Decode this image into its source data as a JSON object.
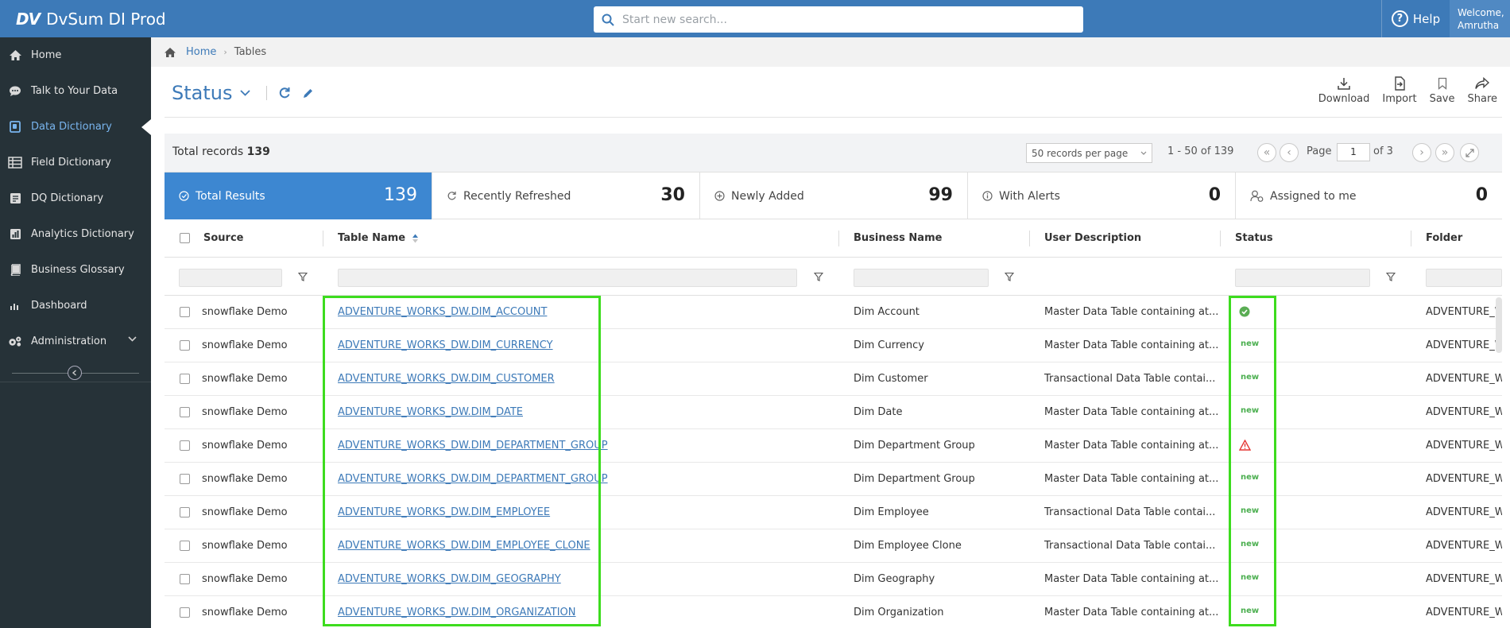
{
  "topbar": {
    "logo_mark": "DV",
    "app_title": "DvSum DI Prod",
    "search_placeholder": "Start new search...",
    "help_label": "Help",
    "welcome_line1": "Welcome,",
    "welcome_line2": "Amrutha",
    "color": "#3d7ab8"
  },
  "sidebar": {
    "items": [
      {
        "label": "Home",
        "icon": "home-icon"
      },
      {
        "label": "Talk to Your Data",
        "icon": "chat-icon"
      },
      {
        "label": "Data Dictionary",
        "icon": "dictionary-icon",
        "active": true
      },
      {
        "label": "Field Dictionary",
        "icon": "field-icon"
      },
      {
        "label": "DQ Dictionary",
        "icon": "dq-icon"
      },
      {
        "label": "Analytics Dictionary",
        "icon": "analytics-icon"
      },
      {
        "label": "Business Glossary",
        "icon": "book-icon"
      },
      {
        "label": "Dashboard",
        "icon": "dashboard-icon"
      },
      {
        "label": "Administration",
        "icon": "gears-icon"
      }
    ]
  },
  "breadcrumb": {
    "home": "Home",
    "current": "Tables"
  },
  "page": {
    "title": "Status"
  },
  "actions": {
    "download": "Download",
    "import": "Import",
    "save": "Save",
    "share": "Share"
  },
  "records": {
    "total_label": "Total records",
    "total": "139",
    "per_page": "50 records per page",
    "range": "1 - 50 of 139",
    "page_label": "Page",
    "page_value": "1",
    "page_of": "of 3"
  },
  "summary": [
    {
      "label": "Total Results",
      "count": "139"
    },
    {
      "label": "Recently Refreshed",
      "count": "30"
    },
    {
      "label": "Newly Added",
      "count": "99"
    },
    {
      "label": "With Alerts",
      "count": "0"
    },
    {
      "label": "Assigned to me",
      "count": "0"
    }
  ],
  "columns": {
    "source": "Source",
    "table_name": "Table Name",
    "business_name": "Business Name",
    "user_description": "User Description",
    "status": "Status",
    "folder": "Folder"
  },
  "status_new_label": "new",
  "rows": [
    {
      "source": "snowflake Demo",
      "table": "ADVENTURE_WORKS_DW.DIM_ACCOUNT",
      "business": "Dim Account",
      "desc": "Master Data Table containing at...",
      "status": "ok",
      "folder": "ADVENTURE_W"
    },
    {
      "source": "snowflake Demo",
      "table": "ADVENTURE_WORKS_DW.DIM_CURRENCY",
      "business": "Dim Currency",
      "desc": "Master Data Table containing at...",
      "status": "new",
      "folder": "ADVENTURE_W"
    },
    {
      "source": "snowflake Demo",
      "table": "ADVENTURE_WORKS_DW.DIM_CUSTOMER",
      "business": "Dim Customer",
      "desc": "Transactional Data Table contai...",
      "status": "new",
      "folder": "ADVENTURE_W"
    },
    {
      "source": "snowflake Demo",
      "table": "ADVENTURE_WORKS_DW.DIM_DATE",
      "business": "Dim Date",
      "desc": "Master Data Table containing at...",
      "status": "new",
      "folder": "ADVENTURE_W"
    },
    {
      "source": "snowflake Demo",
      "table": "ADVENTURE_WORKS_DW.DIM_DEPARTMENT_GROUP",
      "business": "Dim Department Group",
      "desc": "Master Data Table containing at...",
      "status": "alert",
      "folder": "ADVENTURE_W"
    },
    {
      "source": "snowflake Demo",
      "table": "ADVENTURE_WORKS_DW.DIM_DEPARTMENT_GROUP",
      "business": "Dim Department Group",
      "desc": "Master Data Table containing at...",
      "status": "new",
      "folder": "ADVENTURE_W"
    },
    {
      "source": "snowflake Demo",
      "table": "ADVENTURE_WORKS_DW.DIM_EMPLOYEE",
      "business": "Dim Employee",
      "desc": "Transactional Data Table contai...",
      "status": "new",
      "folder": "ADVENTURE_W"
    },
    {
      "source": "snowflake Demo",
      "table": "ADVENTURE_WORKS_DW.DIM_EMPLOYEE_CLONE",
      "business": "Dim Employee Clone",
      "desc": "Transactional Data Table contai...",
      "status": "new",
      "folder": "ADVENTURE_W"
    },
    {
      "source": "snowflake Demo",
      "table": "ADVENTURE_WORKS_DW.DIM_GEOGRAPHY",
      "business": "Dim Geography",
      "desc": "Master Data Table containing at...",
      "status": "new",
      "folder": "ADVENTURE_W"
    },
    {
      "source": "snowflake Demo",
      "table": "ADVENTURE_WORKS_DW.DIM_ORGANIZATION",
      "business": "Dim Organization",
      "desc": "Master Data Table containing at...",
      "status": "new",
      "folder": "ADVENTURE_W"
    }
  ]
}
